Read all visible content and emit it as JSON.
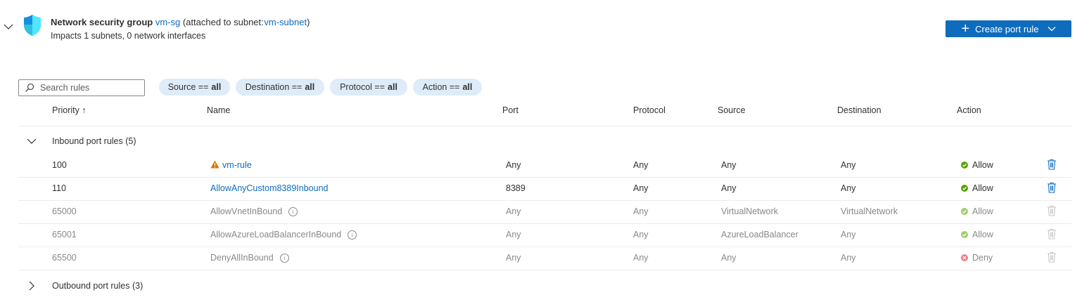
{
  "nsg": {
    "label": "Network security group",
    "name": "vm-sg",
    "attached_prefix": "(attached to subnet:",
    "subnet": "vm-subnet",
    "attached_suffix": ")",
    "impacts": "Impacts 1 subnets, 0 network interfaces",
    "shield_color": "#0078d4"
  },
  "toolbar": {
    "create_label": "Create port rule",
    "search_placeholder": "Search rules"
  },
  "filters": [
    {
      "key": "Source ==",
      "value": "all"
    },
    {
      "key": "Destination ==",
      "value": "all"
    },
    {
      "key": "Protocol ==",
      "value": "all"
    },
    {
      "key": "Action ==",
      "value": "all"
    }
  ],
  "columns": {
    "priority": "Priority ↑",
    "name": "Name",
    "port": "Port",
    "protocol": "Protocol",
    "source": "Source",
    "destination": "Destination",
    "action": "Action"
  },
  "groups": {
    "inbound": "Inbound port rules (5)",
    "outbound": "Outbound port rules (3)"
  },
  "inbound_rules": [
    {
      "priority": "100",
      "name": "vm-rule",
      "port": "Any",
      "protocol": "Any",
      "source": "Any",
      "destination": "Any",
      "action": "Allow",
      "warning": true,
      "default": false
    },
    {
      "priority": "110",
      "name": "AllowAnyCustom8389Inbound",
      "port": "8389",
      "protocol": "Any",
      "source": "Any",
      "destination": "Any",
      "action": "Allow",
      "warning": false,
      "default": false
    },
    {
      "priority": "65000",
      "name": "AllowVnetInBound",
      "port": "Any",
      "protocol": "Any",
      "source": "VirtualNetwork",
      "destination": "VirtualNetwork",
      "action": "Allow",
      "warning": false,
      "default": true
    },
    {
      "priority": "65001",
      "name": "AllowAzureLoadBalancerInBound",
      "port": "Any",
      "protocol": "Any",
      "source": "AzureLoadBalancer",
      "destination": "Any",
      "action": "Allow",
      "warning": false,
      "default": true
    },
    {
      "priority": "65500",
      "name": "DenyAllInBound",
      "port": "Any",
      "protocol": "Any",
      "source": "Any",
      "destination": "Any",
      "action": "Deny",
      "warning": false,
      "default": true
    }
  ],
  "colors": {
    "accent": "#0f6cbd",
    "allow": "#57a300",
    "deny": "#e81123",
    "warning": "#d47500",
    "pill_bg": "#deecf9"
  }
}
